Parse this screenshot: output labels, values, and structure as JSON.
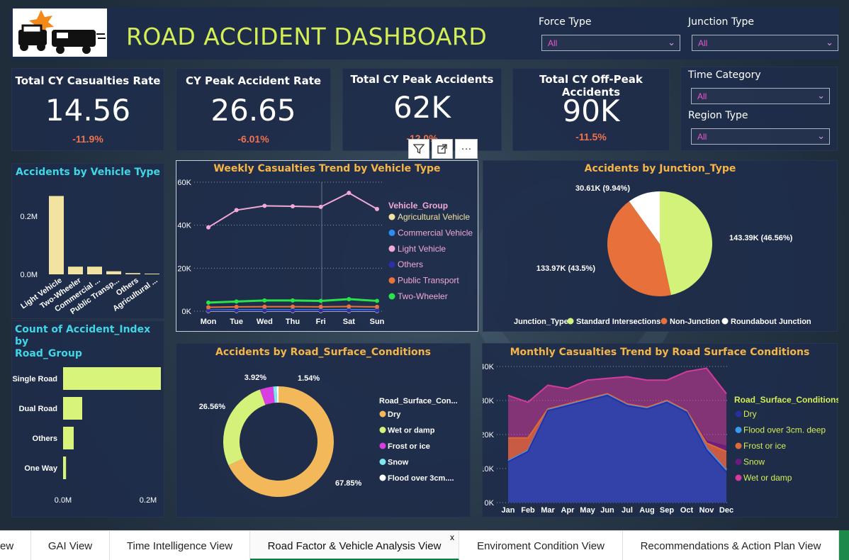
{
  "header": {
    "title": "ROAD ACCIDENT DASHBOARD"
  },
  "slicers": {
    "force_type": {
      "label": "Force Type",
      "value": "All"
    },
    "junction_type": {
      "label": "Junction Type",
      "value": "All"
    },
    "time_category": {
      "label": "Time Category",
      "value": "All"
    },
    "region_type": {
      "label": "Region Type",
      "value": "All"
    }
  },
  "kpis": [
    {
      "title": "Total CY Casualties Rate",
      "value": "14.56",
      "delta": "-11.9%"
    },
    {
      "title": "CY Peak Accident Rate",
      "value": "26.65",
      "delta": "-6.01%"
    },
    {
      "title": "Total CY Peak Accidents",
      "value": "62K",
      "delta": "-12.0%"
    },
    {
      "title": "Total CY Off-Peak Accidents",
      "value": "90K",
      "delta": "-11.5%"
    }
  ],
  "toolbar": {
    "filter_icon": "filter-icon",
    "focus_icon": "focus-mode-icon",
    "more_label": "···"
  },
  "colors": {
    "panel": "#1e2c4a",
    "title_yellow": "#d4ee55",
    "title_cyan": "#3fd6e6",
    "title_orange": "#f5b547",
    "delta_red": "#f0724e",
    "light_green": "#d8f47a"
  },
  "panels": {
    "vehicle_type": {
      "title": "Accidents by Vehicle Type"
    },
    "road_group": {
      "title_line1": "Count of Accident_Index by",
      "title_line2": "Road_Group"
    },
    "weekly": {
      "title": "Weekly Casualties Trend by Vehicle Type",
      "legend_title": "Vehicle_Group"
    },
    "junction": {
      "title": "Accidents by Junction_Type",
      "legend_title": "Junction_Type"
    },
    "surface": {
      "title": "Accidents by Road_Surface_Conditions",
      "legend_title": "Road_Surface_Con..."
    },
    "monthly": {
      "title": "Monthly Casualties Trend by Road Surface Conditions",
      "legend_title": "Road_Surface_Conditions"
    }
  },
  "chart_data": [
    {
      "id": "vehicle_type",
      "type": "bar",
      "title": "Accidents by Vehicle Type",
      "categories": [
        "Light Vehicle",
        "Two-Wheeler",
        "Commercial ...",
        "Public Transp...",
        "Others",
        "Agricultural ..."
      ],
      "values": [
        0.255,
        0.025,
        0.025,
        0.01,
        0.004,
        0.002
      ],
      "value_unit": "M",
      "yticks": [
        "0.2M",
        "0.0M"
      ],
      "ylim": [
        0,
        0.3
      ]
    },
    {
      "id": "road_group",
      "type": "bar",
      "orientation": "horizontal",
      "categories": [
        "Single Road",
        "Dual Road",
        "Others",
        "One Way"
      ],
      "values": [
        0.23,
        0.045,
        0.025,
        0.007
      ],
      "value_unit": "M",
      "xticks": [
        "0.0M",
        "0.2M"
      ],
      "xlim": [
        0,
        0.23
      ]
    },
    {
      "id": "weekly",
      "type": "line",
      "title": "Weekly Casualties Trend by Vehicle Type",
      "categories": [
        "Mon",
        "Tue",
        "Wed",
        "Thu",
        "Fri",
        "Sat",
        "Sun"
      ],
      "yticks": [
        "0K",
        "20K",
        "40K",
        "60K"
      ],
      "ylim": [
        0,
        60000
      ],
      "series": [
        {
          "name": "Agricultural Vehicle",
          "color": "#f3e3a0",
          "values": [
            100,
            100,
            100,
            100,
            100,
            100,
            100
          ]
        },
        {
          "name": "Commercial Vehicle",
          "color": "#2f8cf0",
          "values": [
            500,
            600,
            600,
            600,
            600,
            700,
            600
          ]
        },
        {
          "name": "Light Vehicle",
          "color": "#f2a9d8",
          "values": [
            39000,
            47000,
            49000,
            48800,
            48500,
            55000,
            47500
          ]
        },
        {
          "name": "Others",
          "color": "#2d2fa8",
          "values": [
            300,
            300,
            300,
            300,
            300,
            300,
            300
          ]
        },
        {
          "name": "Public Transport",
          "color": "#e8733c",
          "values": [
            1800,
            2000,
            2100,
            2100,
            2000,
            2200,
            2000
          ]
        },
        {
          "name": "Two-Wheeler",
          "color": "#29e34a",
          "values": [
            4000,
            4500,
            5000,
            5000,
            4800,
            5600,
            4800
          ]
        }
      ]
    },
    {
      "id": "junction",
      "type": "pie",
      "title": "Accidents by Junction_Type",
      "slices": [
        {
          "name": "Standard Intersections",
          "value": 143390,
          "label": "143.39K (46.56%)",
          "color": "#d2f27a"
        },
        {
          "name": "Non-Junction",
          "value": 133970,
          "label": "133.97K (43.5%)",
          "color": "#e8703a"
        },
        {
          "name": "Roundabout Junction",
          "value": 30610,
          "label": "30.61K (9.94%)",
          "color": "#ffffff"
        }
      ]
    },
    {
      "id": "surface",
      "type": "pie",
      "style": "donut",
      "title": "Accidents by Road_Surface_Conditions",
      "slices": [
        {
          "name": "Dry",
          "value": 67.85,
          "label": "67.85%",
          "color": "#f2b85a"
        },
        {
          "name": "Wet or damp",
          "value": 26.56,
          "label": "26.56%",
          "color": "#d4f27a"
        },
        {
          "name": "Frost or ice",
          "value": 3.92,
          "label": "3.92%",
          "color": "#d93ee0"
        },
        {
          "name": "Snow",
          "value": 1.0,
          "label": "",
          "color": "#7ee8ee"
        },
        {
          "name": "Flood over 3cm....",
          "value": 0.54,
          "label": "1.54%",
          "color": "#ffffff"
        }
      ]
    },
    {
      "id": "monthly",
      "type": "area",
      "title": "Monthly Casualties Trend by Road Surface Conditions",
      "categories": [
        "Jan",
        "Feb",
        "Mar",
        "Apr",
        "May",
        "Jun",
        "Jul",
        "Aug",
        "Sep",
        "Oct",
        "Nov",
        "Dec"
      ],
      "yticks": [
        "0K",
        "10K",
        "20K",
        "30K",
        "40K"
      ],
      "ylim": [
        0,
        40000
      ],
      "series": [
        {
          "name": "Dry",
          "color": "#2a2fa0",
          "values": [
            12000,
            15000,
            27000,
            28500,
            30000,
            31500,
            28500,
            27500,
            29500,
            26500,
            15500,
            9000
          ]
        },
        {
          "name": "Flood over 3cm. deep",
          "color": "#3a9af0",
          "values": [
            12300,
            15300,
            27200,
            28700,
            30200,
            31700,
            28700,
            27700,
            29700,
            26700,
            16000,
            9500
          ]
        },
        {
          "name": "Frost or ice",
          "color": "#e06a35",
          "values": [
            19000,
            19000,
            27500,
            29000,
            30500,
            32000,
            29000,
            28000,
            30000,
            27000,
            17500,
            15000
          ]
        },
        {
          "name": "Snow",
          "color": "#6a1a80",
          "values": [
            19000,
            19000,
            27500,
            29000,
            30500,
            32000,
            29000,
            28000,
            30000,
            27000,
            18000,
            16500
          ]
        },
        {
          "name": "Wet or damp",
          "color": "#d63a9c",
          "values": [
            31500,
            29500,
            34500,
            33500,
            36000,
            36500,
            37000,
            36000,
            36000,
            38500,
            39500,
            32000
          ]
        }
      ]
    }
  ],
  "tabs": [
    {
      "label": "ew",
      "active": false
    },
    {
      "label": "GAI View",
      "active": false
    },
    {
      "label": "Time Intelligence View",
      "active": false
    },
    {
      "label": "Road Factor & Vehicle Analysis View",
      "active": true,
      "close": "x"
    },
    {
      "label": "Enviroment Condition View",
      "active": false
    },
    {
      "label": "Recommendations & Action Plan View",
      "active": false
    }
  ]
}
